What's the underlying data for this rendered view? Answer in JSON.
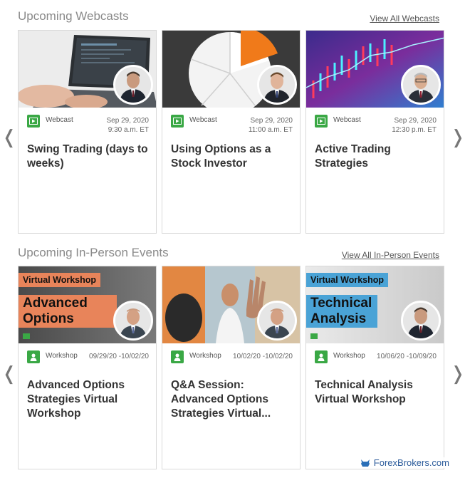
{
  "webcasts": {
    "heading": "Upcoming Webcasts",
    "view_all": "View All Webcasts",
    "cards": [
      {
        "type": "Webcast",
        "date": "Sep 29, 2020",
        "time": "9:30 a.m. ET",
        "title": "Swing Trading (days to weeks)"
      },
      {
        "type": "Webcast",
        "date": "Sep 29, 2020",
        "time": "11:00 a.m. ET",
        "title": "Using Options as a Stock Investor"
      },
      {
        "type": "Webcast",
        "date": "Sep 29, 2020",
        "time": "12:30 p.m. ET",
        "title": "Active Trading Strategies"
      }
    ]
  },
  "events": {
    "heading": "Upcoming In-Person Events",
    "view_all": "View All In-Person Events",
    "cards": [
      {
        "type": "Workshop",
        "date": "09/29/20 -10/02/20",
        "title": "Advanced Options Strategies Virtual Workshop",
        "banner_tag": "Virtual Workshop",
        "banner_title": "Advanced Options Strate"
      },
      {
        "type": "Workshop",
        "date": "10/02/20 -10/02/20",
        "title": "Q&A Session: Advanced Options Strategies Virtual..."
      },
      {
        "type": "Workshop",
        "date": "10/06/20 -10/09/20",
        "title": "Technical Analysis Virtual Workshop",
        "banner_tag": "Virtual Workshop",
        "banner_title": "Technical Analysis"
      }
    ]
  },
  "arrows": {
    "left": "❬",
    "right": "❭"
  },
  "watermark": "ForexBrokers.com",
  "colors": {
    "accent_green": "#3aa845",
    "orange_banner": "#e8845a",
    "blue_banner": "#4aa3d6"
  }
}
